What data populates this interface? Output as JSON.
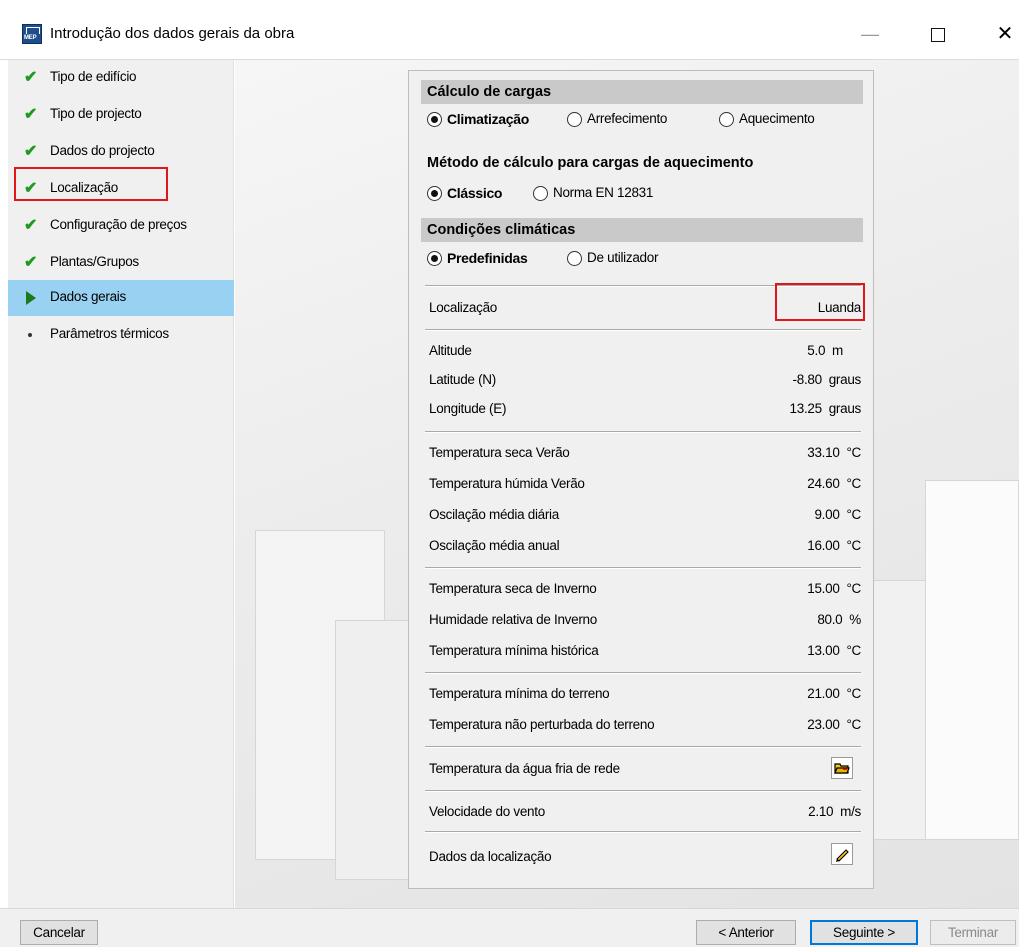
{
  "window": {
    "title": "Introdução dos dados gerais da obra",
    "minimize": "—",
    "close": "✕"
  },
  "sidebar": {
    "steps": [
      {
        "label": "Tipo de edifício",
        "state": "done"
      },
      {
        "label": "Tipo de projecto",
        "state": "done"
      },
      {
        "label": "Dados do projecto",
        "state": "done"
      },
      {
        "label": "Localização",
        "state": "done"
      },
      {
        "label": "Configuração de preços",
        "state": "done"
      },
      {
        "label": "Plantas/Grupos",
        "state": "done"
      },
      {
        "label": "Dados gerais",
        "state": "current"
      },
      {
        "label": "Parâmetros térmicos",
        "state": "pending"
      }
    ]
  },
  "panel": {
    "load_calc": {
      "heading": "Cálculo de cargas",
      "options": [
        "Climatização",
        "Arrefecimento",
        "Aquecimento"
      ],
      "selected": "Climatização"
    },
    "heating_method": {
      "heading": "Método de cálculo para cargas de aquecimento",
      "options": [
        "Clássico",
        "Norma EN 12831"
      ],
      "selected": "Clássico"
    },
    "climate": {
      "heading": "Condições climáticas",
      "options": [
        "Predefinidas",
        "De utilizador"
      ],
      "selected": "Predefinidas"
    },
    "location": {
      "label": "Localização",
      "value": "Luanda"
    },
    "geo": [
      {
        "label": "Altitude",
        "value": "5.0  m"
      },
      {
        "label": "Latitude (N)",
        "value": "-8.80  graus"
      },
      {
        "label": "Longitude (E)",
        "value": "13.25  graus"
      }
    ],
    "summer": [
      {
        "label": "Temperatura seca Verão",
        "value": "33.10  °C"
      },
      {
        "label": "Temperatura húmida Verão",
        "value": "24.60  °C"
      },
      {
        "label": "Oscilação média diária",
        "value": "9.00  °C"
      },
      {
        "label": "Oscilação média anual",
        "value": "16.00  °C"
      }
    ],
    "winter": [
      {
        "label": "Temperatura seca de Inverno",
        "value": "15.00  °C"
      },
      {
        "label": "Humidade relativa de Inverno",
        "value": "80.0  %"
      },
      {
        "label": "Temperatura mínima histórica",
        "value": "13.00  °C"
      }
    ],
    "ground": [
      {
        "label": "Temperatura mínima do terreno",
        "value": "21.00  °C"
      },
      {
        "label": "Temperatura não perturbada do terreno",
        "value": "23.00  °C"
      }
    ],
    "water": {
      "label": "Temperatura da água fria de rede"
    },
    "wind": {
      "label": "Velocidade do vento",
      "value": "2.10  m/s"
    },
    "location_data": {
      "label": "Dados da localização"
    }
  },
  "footer": {
    "cancel": "Cancelar",
    "previous": "< Anterior",
    "next": "Seguinte >",
    "finish": "Terminar"
  }
}
